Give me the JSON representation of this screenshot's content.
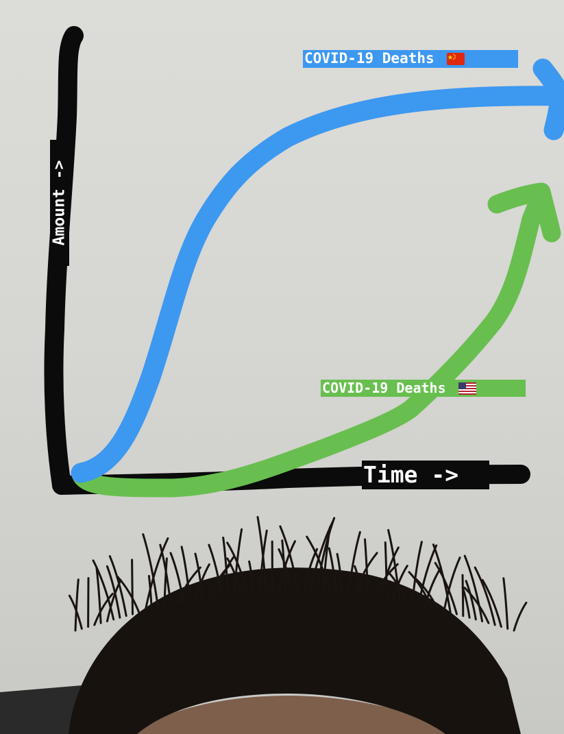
{
  "labels": {
    "china_line": "COVID-19 Deaths",
    "us_line": "COVID-19 Deaths",
    "x_axis": "Time ->",
    "y_axis": "Amount ->"
  },
  "flags": {
    "china": "china-flag-icon",
    "us": "us-flag-icon"
  },
  "colors": {
    "axis": "#0b0b0b",
    "china_line": "#3d98f0",
    "us_line": "#68bf4f",
    "wall": "#d8d8d4",
    "hair": "#1a1512",
    "skin": "#8a6a55",
    "dark_corner": "#2a2a2a"
  }
}
